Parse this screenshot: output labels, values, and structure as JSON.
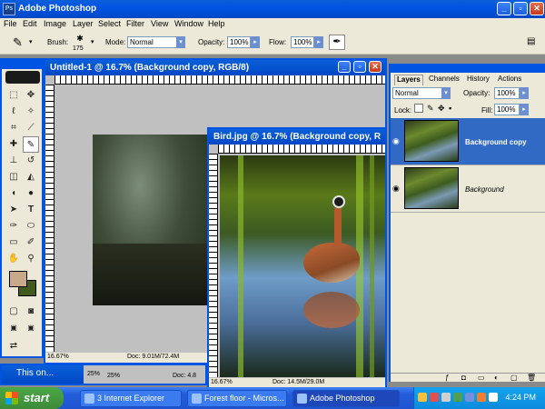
{
  "app": {
    "title": "Adobe Photoshop"
  },
  "menu": [
    "File",
    "Edit",
    "Image",
    "Layer",
    "Select",
    "Filter",
    "View",
    "Window",
    "Help"
  ],
  "options": {
    "brush_label": "Brush:",
    "brush_size": "175",
    "mode_label": "Mode:",
    "mode_value": "Normal",
    "opacity_label": "Opacity:",
    "opacity_value": "100%",
    "flow_label": "Flow:",
    "flow_value": "100%"
  },
  "doc1": {
    "title": "Untitled-1 @ 16.7% (Background copy, RGB/8)",
    "zoom": "16.67%",
    "doc_size": "Doc: 9.01M/72.4M"
  },
  "doc2": {
    "title": "Bird.jpg @ 16.7% (Background copy, R",
    "zoom": "16.67%",
    "doc_size": "Doc: 14.5M/29.0M"
  },
  "minimized": {
    "title": "This on...",
    "zoom1": "25%",
    "zoom2": "25%",
    "doc_size": "Doc: 4.8"
  },
  "layers_panel": {
    "tabs": [
      "Layers",
      "Channels",
      "History",
      "Actions"
    ],
    "blend_mode": "Normal",
    "opacity_label": "Opacity:",
    "opacity_value": "100%",
    "lock_label": "Lock:",
    "fill_label": "Fill:",
    "fill_value": "100%",
    "layers": [
      {
        "name": "Background copy",
        "selected": true
      },
      {
        "name": "Background",
        "selected": false
      }
    ]
  },
  "taskbar": {
    "start_label": "start",
    "tasks": [
      "3 Internet Explorer",
      "Forest floor - Micros...",
      "Adobe Photoshop"
    ],
    "clock": "4:24 PM"
  },
  "colors": {
    "xp_blue": "#0054e3",
    "panel_bg": "#ece9d8",
    "selection": "#316ac5",
    "foreground_swatch": "#c9a98a",
    "background_swatch": "#3f5a1c"
  }
}
